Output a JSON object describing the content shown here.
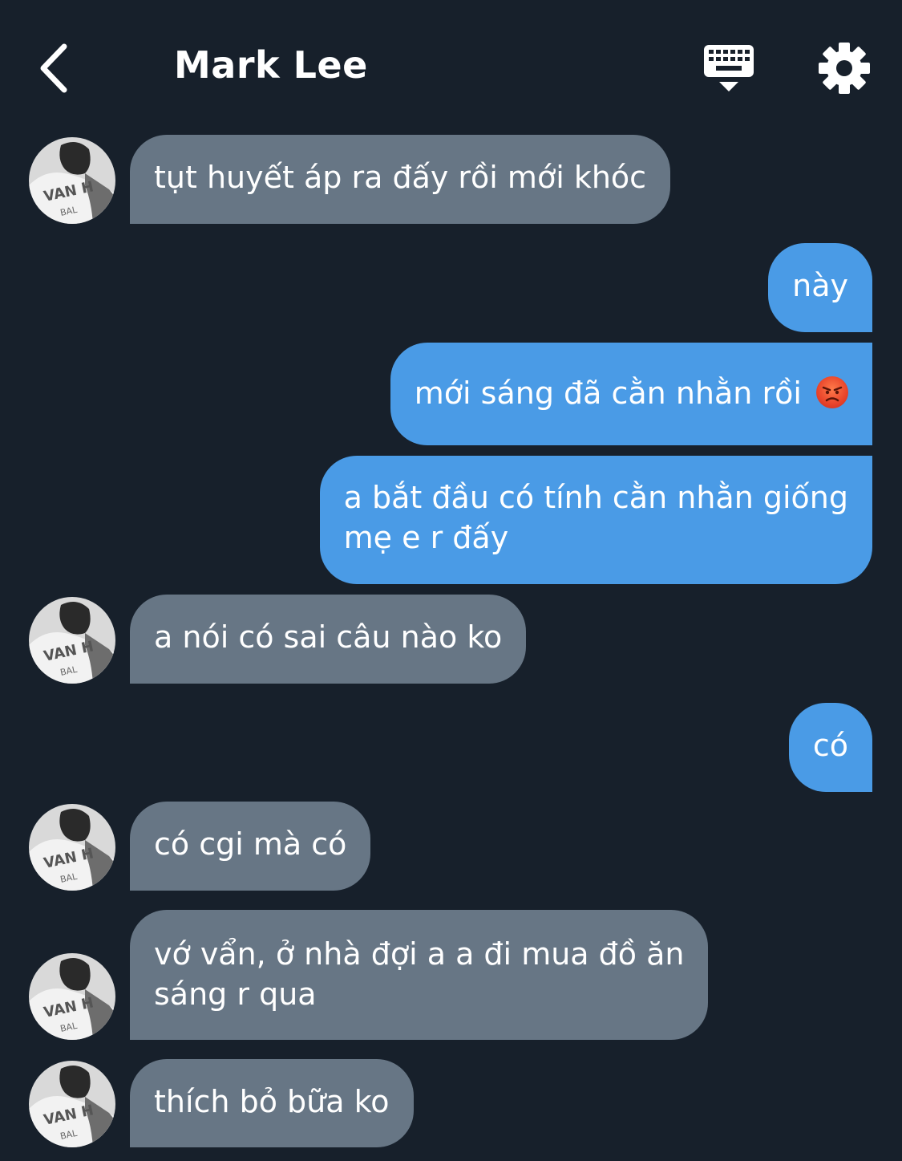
{
  "header": {
    "title": "Mark Lee",
    "back_icon": "chevron-left-icon",
    "keyboard_icon": "keyboard-hide-icon",
    "settings_icon": "gear-icon"
  },
  "colors": {
    "background": "#17202b",
    "incoming_bubble": "#677685",
    "outgoing_bubble": "#4a9be6",
    "text": "#ffffff"
  },
  "messages": [
    {
      "sender": "contact",
      "text": "tụt huyết áp ra đấy rồi mới khóc"
    },
    {
      "sender": "me",
      "text": "này"
    },
    {
      "sender": "me",
      "text": "mới sáng đã cằn nhằn rồi",
      "emoji": "angry-face-emoji"
    },
    {
      "sender": "me",
      "text_line1": "a bắt đầu có tính cằn nhằn giống",
      "text_line2": "mẹ e r đấy"
    },
    {
      "sender": "contact",
      "text": "a nói có sai câu nào ko"
    },
    {
      "sender": "me",
      "text": "có"
    },
    {
      "sender": "contact",
      "text": "có cgi mà có"
    },
    {
      "sender": "contact",
      "text_line1": "vớ vẩn, ở nhà đợi a a đi mua đồ ăn",
      "text_line2": "sáng r qua"
    },
    {
      "sender": "contact",
      "text": "thích bỏ bữa ko"
    }
  ]
}
